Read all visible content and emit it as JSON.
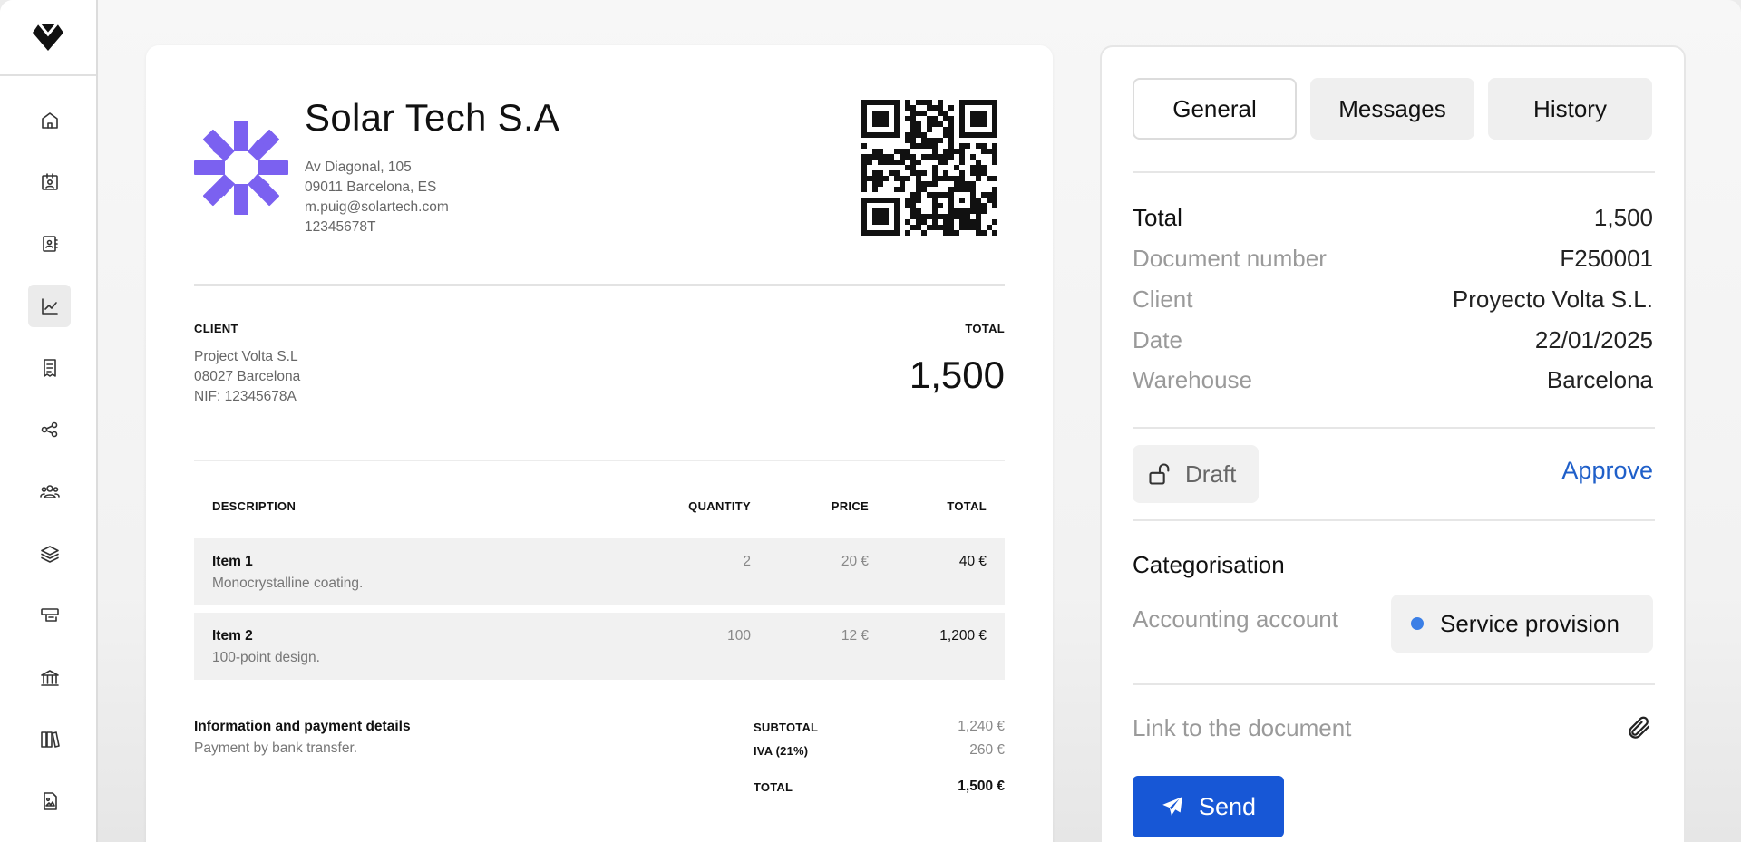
{
  "sidebar": {
    "logo": "diamond-logo",
    "items": [
      {
        "icon": "home-icon"
      },
      {
        "icon": "contact-card-icon"
      },
      {
        "icon": "address-book-icon"
      },
      {
        "icon": "chart-icon",
        "active": true
      },
      {
        "icon": "receipt-icon"
      },
      {
        "icon": "share-icon"
      },
      {
        "icon": "users-icon"
      },
      {
        "icon": "layers-icon"
      },
      {
        "icon": "stamp-icon"
      },
      {
        "icon": "bank-icon"
      },
      {
        "icon": "books-icon"
      },
      {
        "icon": "image-file-icon"
      }
    ]
  },
  "invoice": {
    "company": {
      "name": "Solar Tech S.A",
      "address": "Av Diagonal, 105",
      "city": "09011 Barcelona, ES",
      "email": "m.puig@solartech.com",
      "tax_id": "12345678T",
      "logo_color": "#7b61f0"
    },
    "client_caption": "CLIENT",
    "total_caption": "TOTAL",
    "client": {
      "name": "Project Volta S.L",
      "city": "08027 Barcelona",
      "nif": "NIF: 12345678A"
    },
    "total_amount": "1,500",
    "table": {
      "headers": {
        "description": "DESCRIPTION",
        "quantity": "QUANTITY",
        "price": "PRICE",
        "total": "TOTAL"
      },
      "rows": [
        {
          "name": "Item 1",
          "desc": "Monocrystalline coating.",
          "quantity": "2",
          "price": "20 €",
          "total": "40 €"
        },
        {
          "name": "Item 2",
          "desc": "100-point design.",
          "quantity": "100",
          "price": "12 €",
          "total": "1,200 €"
        }
      ]
    },
    "payment": {
      "title": "Information and payment details",
      "desc": "Payment by bank transfer."
    },
    "summary": {
      "subtotal_label": "SUBTOTAL",
      "subtotal": "1,240 €",
      "iva_label": "IVA (21%)",
      "iva": "260 €",
      "total_label": "TOTAL",
      "total": "1,500 €"
    }
  },
  "panel": {
    "tabs": [
      {
        "label": "General",
        "active": true
      },
      {
        "label": "Messages"
      },
      {
        "label": "History"
      }
    ],
    "details": {
      "total_label": "Total",
      "total": "1,500",
      "docnum_label": "Document number",
      "docnum": "F250001",
      "client_label": "Client",
      "client": "Proyecto Volta S.L.",
      "date_label": "Date",
      "date": "22/01/2025",
      "warehouse_label": "Warehouse",
      "warehouse": "Barcelona"
    },
    "status": "Draft",
    "approve_label": "Approve",
    "categorisation_title": "Categorisation",
    "account_label": "Accounting account",
    "account_value": "Service provision",
    "account_dot_color": "#3b7fe6",
    "link_label": "Link to the document",
    "send_label": "Send",
    "accent_color": "#1757d6"
  }
}
